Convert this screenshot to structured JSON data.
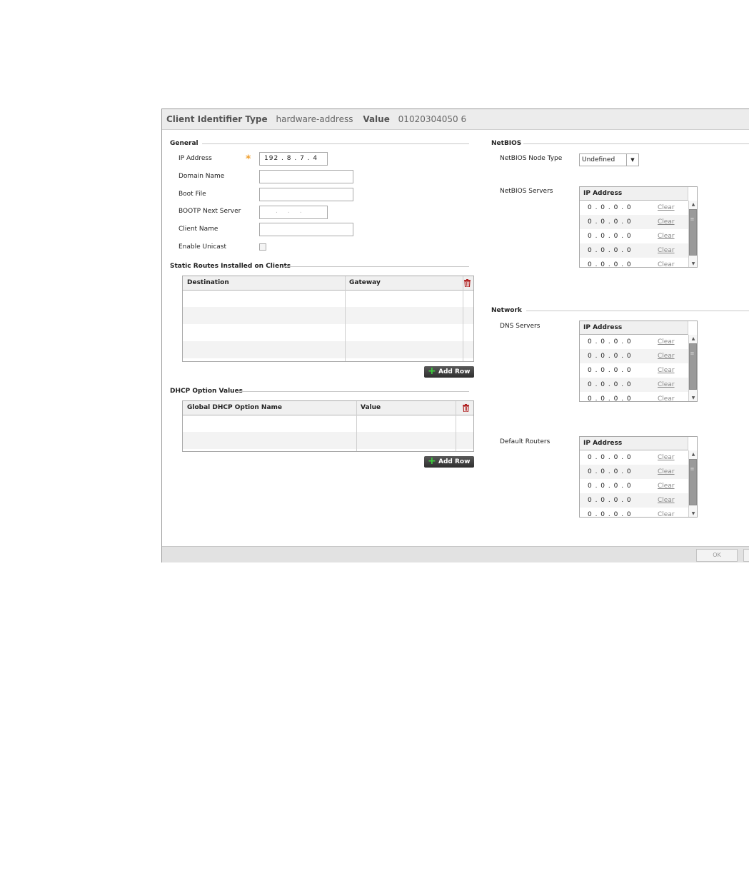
{
  "header": {
    "client_id_label": "Client Identifier Type",
    "client_id_value": "hardware-address",
    "value_label": "Value",
    "value_value": "01020304050 6"
  },
  "general": {
    "section": "General",
    "ip_label": "IP Address",
    "ip_value": "192 . 8 . 7 . 4",
    "domain_label": "Domain Name",
    "bootfile_label": "Boot File",
    "bootp_label": "BOOTP Next Server",
    "client_name_label": "Client Name",
    "unicast_label": "Enable Unicast"
  },
  "static_routes": {
    "section": "Static Routes Installed on Clients",
    "columns": [
      "Destination",
      "Gateway"
    ],
    "add_row": "Add Row"
  },
  "dhcp_options": {
    "section": "DHCP Option Values",
    "columns": [
      "Global DHCP Option Name",
      "Value"
    ],
    "add_row": "Add Row"
  },
  "netbios": {
    "section": "NetBIOS",
    "node_type_label": "NetBIOS Node Type",
    "node_type_value": "Undefined",
    "servers_label": "NetBIOS Servers"
  },
  "network": {
    "section": "Network",
    "dns_label": "DNS Servers",
    "routers_label": "Default Routers"
  },
  "ip_list": {
    "header": "IP Address",
    "rows": [
      {
        "ip": "0 . 0 . 0 . 0",
        "clear": "Clear"
      },
      {
        "ip": "0 . 0 . 0 . 0",
        "clear": "Clear"
      },
      {
        "ip": "0 . 0 . 0 . 0",
        "clear": "Clear"
      },
      {
        "ip": "0 . 0 . 0 . 0",
        "clear": "Clear"
      },
      {
        "ip": "0 . 0 . 0 . 0",
        "clear": "Clear"
      }
    ]
  },
  "footer": {
    "ok_label": "OK"
  },
  "colors": {
    "required_star": "#f0a030",
    "trash": "#b02020",
    "add_plus": "#3cd03c"
  },
  "icons": [
    "required-star-icon",
    "trash-icon",
    "plus-icon",
    "dropdown-arrow-icon",
    "scroll-up-icon",
    "scroll-down-icon"
  ]
}
